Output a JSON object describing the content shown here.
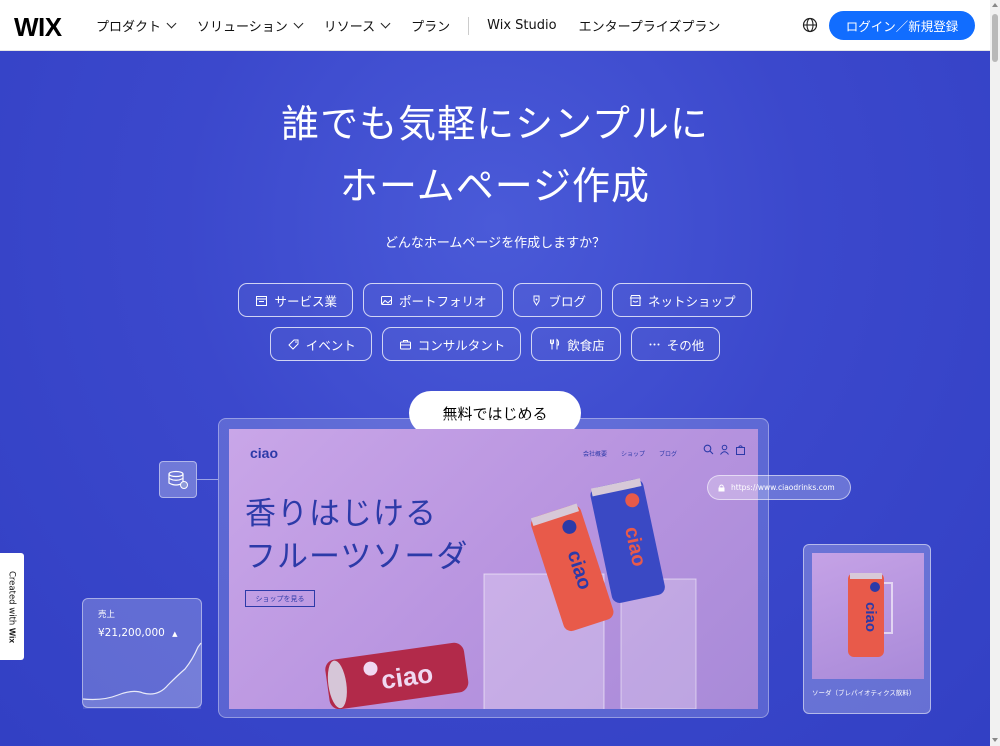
{
  "header": {
    "logo": "WIX",
    "nav": [
      {
        "label": "プロダクト",
        "dropdown": true
      },
      {
        "label": "ソリューション",
        "dropdown": true
      },
      {
        "label": "リソース",
        "dropdown": true
      },
      {
        "label": "プラン",
        "dropdown": false
      }
    ],
    "nav_secondary": [
      "Wix Studio",
      "エンタープライズプラン"
    ],
    "language_icon": "globe-icon",
    "login_button": "ログイン／新規登録"
  },
  "hero": {
    "title_line1": "誰でも気軽にシンプルに",
    "title_line2": "ホームページ作成",
    "subtitle": "どんなホームページを作成しますか？",
    "categories_row1": [
      {
        "label": "サービス業",
        "icon": "calendar-icon"
      },
      {
        "label": "ポートフォリオ",
        "icon": "image-icon"
      },
      {
        "label": "ブログ",
        "icon": "pen-icon"
      },
      {
        "label": "ネットショップ",
        "icon": "store-icon"
      }
    ],
    "categories_row2": [
      {
        "label": "イベント",
        "icon": "ticket-icon"
      },
      {
        "label": "コンサルタント",
        "icon": "briefcase-icon"
      },
      {
        "label": "飲食店",
        "icon": "cutlery-icon"
      },
      {
        "label": "その他",
        "icon": "more-icon"
      }
    ],
    "cta": "無料ではじめる"
  },
  "mockup": {
    "site_logo": "ciao",
    "site_nav": [
      "会社概要",
      "ショップ",
      "ブログ"
    ],
    "headline_line1": "香りはじける",
    "headline_line2": "フルーツソーダ",
    "shop_button": "ショップを見る",
    "can_text": "ciao",
    "url": "https://www.ciaodrinks.com",
    "sales_label": "売上",
    "sales_value": "¥21,200,000",
    "product_label": "ソーダ（ブレパイオティクス飲料）"
  },
  "badge": {
    "prefix": "Created with",
    "brand": "Wix"
  },
  "colors": {
    "accent": "#116dff",
    "hero_bg": "#3b48cc",
    "site_text": "#2c3aa8"
  }
}
